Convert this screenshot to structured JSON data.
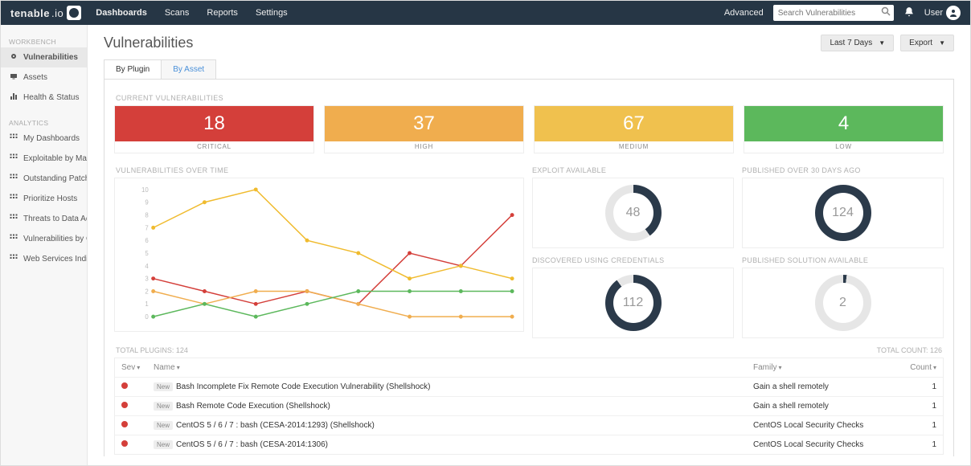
{
  "brand": {
    "part1": "tenable",
    "part2": ".io",
    "badge": "io"
  },
  "topnav": {
    "items": [
      "Dashboards",
      "Scans",
      "Reports",
      "Settings"
    ],
    "activeIndex": 0
  },
  "topbar": {
    "advanced": "Advanced",
    "searchPlaceholder": "Search Vulnerabilities",
    "user": "User"
  },
  "sidebar": {
    "workbench": {
      "label": "WORKBENCH",
      "items": [
        "Vulnerabilities",
        "Assets",
        "Health & Status"
      ],
      "activeIndex": 0
    },
    "analytics": {
      "label": "ANALYTICS",
      "items": [
        "My Dashboards",
        "Exploitable by Mal…",
        "Outstanding Patch…",
        "Prioritize Hosts",
        "Threats to Data Ac…",
        "Vulnerabilities by C…",
        "Web Services Indic…"
      ]
    }
  },
  "page": {
    "title": "Vulnerabilities"
  },
  "controls": {
    "range": "Last 7 Days",
    "export": "Export"
  },
  "tabs": {
    "items": [
      "By Plugin",
      "By Asset"
    ],
    "activeIndex": 0
  },
  "sections": {
    "current": "CURRENT VULNERABILITIES",
    "overtime": "VULNERABILITIES OVER TIME",
    "exploit": "EXPLOIT AVAILABLE",
    "published30": "PUBLISHED OVER 30 DAYS AGO",
    "credentials": "DISCOVERED USING CREDENTIALS",
    "solution": "PUBLISHED SOLUTION AVAILABLE"
  },
  "severityCards": [
    {
      "value": "18",
      "label": "CRITICAL",
      "class": "crit"
    },
    {
      "value": "37",
      "label": "HIGH",
      "class": "high"
    },
    {
      "value": "67",
      "label": "MEDIUM",
      "class": "med"
    },
    {
      "value": "4",
      "label": "LOW",
      "class": "low"
    }
  ],
  "donuts": {
    "exploit": {
      "value": "48",
      "percent": 40
    },
    "published30": {
      "value": "124",
      "percent": 100
    },
    "credentials": {
      "value": "112",
      "percent": 90
    },
    "solution": {
      "value": "2",
      "percent": 2
    }
  },
  "colors": {
    "critical": "#d43f3a",
    "high": "#f0ad4e",
    "medium": "#f0bb2e",
    "low": "#5cb85c",
    "ring": "#2b3a4a",
    "ringBg": "#e6e6e6"
  },
  "chart_data": {
    "type": "line",
    "title": "Vulnerabilities over time",
    "xlabel": "",
    "ylabel": "",
    "ylim": [
      0,
      10
    ],
    "x": [
      1,
      2,
      3,
      4,
      5,
      6,
      7,
      8
    ],
    "yticks": [
      0,
      1,
      2,
      3,
      4,
      5,
      6,
      7,
      8,
      9,
      10
    ],
    "series": [
      {
        "name": "Critical",
        "color": "#d43f3a",
        "values": [
          3,
          2,
          1,
          2,
          1,
          5,
          4,
          8
        ]
      },
      {
        "name": "High",
        "color": "#f0ad4e",
        "values": [
          2,
          1,
          2,
          2,
          1,
          0,
          0,
          0
        ]
      },
      {
        "name": "Medium",
        "color": "#f0bb2e",
        "values": [
          7,
          9,
          10,
          6,
          5,
          3,
          4,
          3
        ]
      },
      {
        "name": "Low",
        "color": "#5cb85c",
        "values": [
          0,
          1,
          0,
          1,
          2,
          2,
          2,
          2
        ]
      }
    ]
  },
  "table": {
    "headerLeft": "TOTAL PLUGINS: 124",
    "headerRight": "TOTAL COUNT: 126",
    "columns": {
      "sev": "Sev",
      "name": "Name",
      "family": "Family",
      "count": "Count"
    },
    "rows": [
      {
        "name": "Bash Incomplete Fix Remote Code Execution Vulnerability (Shellshock)",
        "family": "Gain a shell remotely",
        "count": "1"
      },
      {
        "name": "Bash Remote Code Execution (Shellshock)",
        "family": "Gain a shell remotely",
        "count": "1"
      },
      {
        "name": "CentOS 5 / 6 / 7 : bash (CESA-2014:1293) (Shellshock)",
        "family": "CentOS Local Security Checks",
        "count": "1"
      },
      {
        "name": "CentOS 5 / 6 / 7 : bash (CESA-2014:1306)",
        "family": "CentOS Local Security Checks",
        "count": "1"
      }
    ],
    "newBadge": "New"
  }
}
